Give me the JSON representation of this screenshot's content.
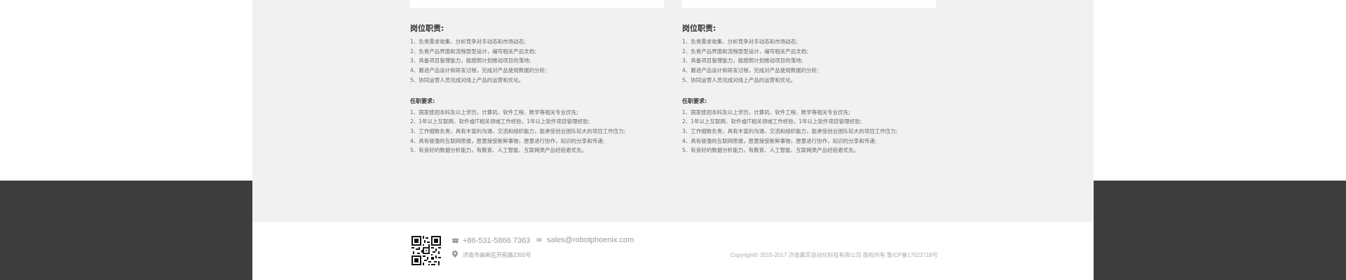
{
  "jobs": [
    {
      "heading": "岗位职责:",
      "duties": [
        "1、负责需求收集、分析竞争对手动态和市场动态;",
        "2、负责产品界面和流程原型设计，编写相关产品文档;",
        "3、具备项目管理能力，能按照计划推动项目的落地;",
        "4、跟进产品设计和研发过程，完成对产品使用数据的分析;",
        "5、协同运营人员完成对线上产品的运营和优化。"
      ],
      "req_heading": "任职要求:",
      "requirements": [
        "1、国家统招本科及以上学历，计算机、软件工程、数学等相关专业优先;",
        "2、1年以上互联网、软件或IT相关领域工作经验，1年以上软件项目管理经验;",
        "3、工作细致负责，具有丰富的沟通、交流和组织能力，能承受创业团队较大的项目工作压力;",
        "4、具有极强的互联网思维，愿意接受新鲜事物，愿意进行协作，知识的分享和传递;",
        "5、有良好的数据分析能力，有教育、人工智能、互联网类产品经验者优先。"
      ]
    },
    {
      "heading": "岗位职责:",
      "duties": [
        "1、负责需求收集、分析竞争对手动态和市场动态;",
        "2、负责产品界面和流程原型设计，编写相关产品文档;",
        "3、具备项目管理能力，能按照计划推动项目的落地;",
        "4、跟进产品设计和研发过程，完成对产品使用数据的分析;",
        "5、协同运营人员完成对线上产品的运营和优化。"
      ],
      "req_heading": "任职要求:",
      "requirements": [
        "1、国家统招本科及以上学历，计算机、软件工程、数学等相关专业优先;",
        "2、1年以上互联网、软件或IT相关领域工作经验，1年以上软件项目管理经验;",
        "3、工作细致负责，具有丰富的沟通、交流和组织能力，能承受创业团队较大的项目工作压力;",
        "4、具有极强的互联网思维，愿意接受新鲜事物，愿意进行协作，知识的分享和传递;",
        "5、有良好的数据分析能力，有教育、人工智能、互联网类产品经验者优先。"
      ]
    }
  ],
  "footer": {
    "phone": "+86-531-5866 7363",
    "email": "sales@robotphoenix.com",
    "address": "济南市高新区开拓路2350号",
    "copyright": "Copyright© 2015-2017 济南翼菲自动化科技有限公司 版权所有 鲁ICP备17022718号",
    "phone_icon": "phone-icon",
    "email_icon": "mail-icon",
    "address_icon": "location-pin-icon"
  },
  "colors": {
    "content_bg": "#f1f1f1",
    "dark_band": "#3d3d3d",
    "text": "#666666"
  }
}
